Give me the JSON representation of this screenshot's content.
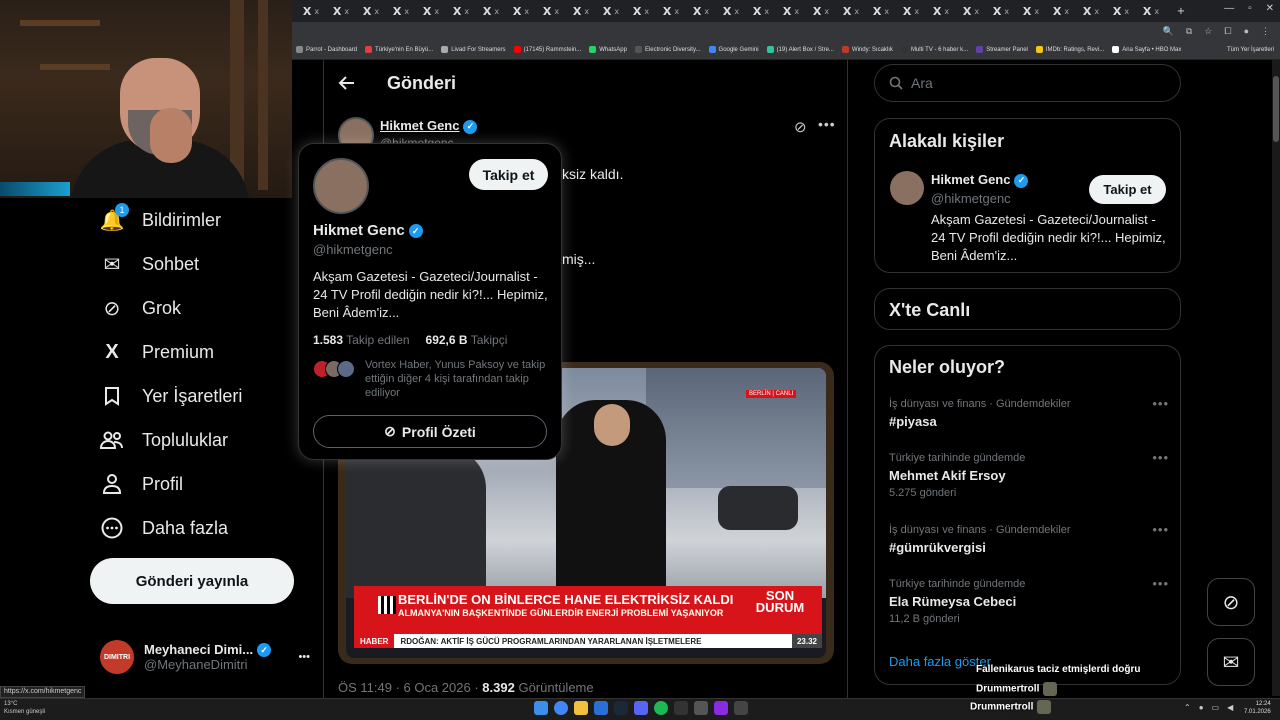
{
  "browser": {
    "tab_x_label": "X",
    "tab_count_label": "x",
    "active_tab_label": "X (1)",
    "new_tab": "+",
    "window_controls": [
      "—",
      "▫",
      "✕"
    ],
    "bookmarks": [
      {
        "label": "Parrot - Dashboard",
        "color": "#888888"
      },
      {
        "label": "Türkiye'nin En Büyü...",
        "color": "#e04040"
      },
      {
        "label": "Livad For Streamers",
        "color": "#aaaaaa"
      },
      {
        "label": "(17145) Rammstein...",
        "color": "#ff0000"
      },
      {
        "label": "WhatsApp",
        "color": "#25d366"
      },
      {
        "label": "Electronic Diversity...",
        "color": "#555555"
      },
      {
        "label": "Google Gemini",
        "color": "#4285f4"
      },
      {
        "label": "(19) Alert Box / Stre...",
        "color": "#31c3a2"
      },
      {
        "label": "Windy: Sıcaklık",
        "color": "#c0392b"
      },
      {
        "label": "Multi TV - 6 haber k...",
        "color": "#333333"
      },
      {
        "label": "Streamer Panel",
        "color": "#6441a5"
      },
      {
        "label": "IMDb: Ratings, Revi...",
        "color": "#f5c518"
      },
      {
        "label": "Ana Sayfa • HBO Max",
        "color": "#ffffff"
      }
    ],
    "all_bookmarks": "Tüm Yer İşaretleri",
    "status_url": "https://x.com/hikmetgenc"
  },
  "nav": {
    "items": [
      {
        "label": "Bildirimler",
        "icon": "bell-icon",
        "badge": "1"
      },
      {
        "label": "Sohbet",
        "icon": "mail-icon"
      },
      {
        "label": "Grok",
        "icon": "grok-icon"
      },
      {
        "label": "Premium",
        "icon": "x-logo-icon"
      },
      {
        "label": "Yer İşaretleri",
        "icon": "bookmark-icon"
      },
      {
        "label": "Topluluklar",
        "icon": "communities-icon"
      },
      {
        "label": "Profil",
        "icon": "profile-icon"
      },
      {
        "label": "Daha fazla",
        "icon": "more-circle-icon"
      }
    ],
    "post_button": "Gönderi yayınla",
    "account": {
      "name": "Meyhaneci Dimi...",
      "handle": "@MeyhaneDimitri",
      "more": "•••",
      "avatar_text": "DIMITRI"
    }
  },
  "post": {
    "header_title": "Gönderi",
    "author_name": "Hikmet Genc",
    "author_handle": "@hikmetgenc",
    "text_line1": "ksiz kaldı.",
    "text_line2": "miş...",
    "media": {
      "location_tag": "BERLİN | CANLI",
      "headline": "BERLİN'DE ON BİNLERCE HANE ELEKTRİKSİZ KALDI",
      "subheadline": "ALMANYA'NIN BAŞKENTİNDE GÜNLERDİR ENERJİ PROBLEMİ YAŞANIYOR",
      "son_durum": "SON DURUM",
      "ticker_tag": "HABER",
      "ticker_text": "RDOĞAN: AKTİF İŞ GÜCÜ PROGRAMLARINDAN YARARLANAN İŞLETMELERE",
      "ticker_time": "23.32"
    },
    "timestamp": "ÖS 11:49 · 6 Oca 2026 · ",
    "views_count": "8.392",
    "views_label": " Görüntüleme"
  },
  "hovercard": {
    "follow_button": "Takip et",
    "name": "Hikmet Genc",
    "handle": "@hikmetgenc",
    "bio": "Akşam Gazetesi - Gazeteci/Journalist - 24 TV Profil dediğin nedir ki?!... Hepimiz, Beni Âdem'iz...",
    "following_count": "1.583",
    "following_label": "Takip edilen",
    "followers_count": "692,6 B",
    "followers_label": "Takipçi",
    "followed_by": "Vortex Haber, Yunus Paksoy ve takip ettiğin diğer 4 kişi tarafından takip ediliyor",
    "profile_summary": "Profil Özeti"
  },
  "sidebar": {
    "search_placeholder": "Ara",
    "relevant_title": "Alakalı kişiler",
    "relevant": {
      "name": "Hikmet Genc",
      "handle": "@hikmetgenc",
      "follow": "Takip et",
      "bio": "Akşam Gazetesi - Gazeteci/Journalist - 24 TV Profil dediğin nedir ki?!... Hepimiz, Beni Âdem'iz..."
    },
    "live_title": "X'te Canlı",
    "trends_title": "Neler oluyor?",
    "trends": [
      {
        "category": "İş dünyası ve finans · Gündemdekiler",
        "name": "#piyasa",
        "count": ""
      },
      {
        "category": "Türkiye tarihinde gündemde",
        "name": "Mehmet Akif Ersoy",
        "count": "5.275 gönderi"
      },
      {
        "category": "İş dünyası ve finans · Gündemdekiler",
        "name": "#gümrükvergisi",
        "count": ""
      },
      {
        "category": "Türkiye tarihinde gündemde",
        "name": "Ela Rümeysa Cebeci",
        "count": "11,2 B gönderi"
      }
    ],
    "show_more": "Daha fazla göster"
  },
  "chat_overlay": [
    {
      "user": "Fallenikarus",
      "message": "taciz etmişlerdi doğru"
    },
    {
      "user": "Drummertroll",
      "message": ""
    },
    {
      "user": "Drummertroll",
      "message": ""
    }
  ],
  "taskbar": {
    "weather_temp": "13°C",
    "weather_desc": "Kısmen güneşli",
    "time": "12:24",
    "date": "7.01.2026"
  },
  "colors": {
    "accent": "#1d9bf0",
    "background": "#000000",
    "border": "#2f3336",
    "news_red": "#d7141a"
  }
}
